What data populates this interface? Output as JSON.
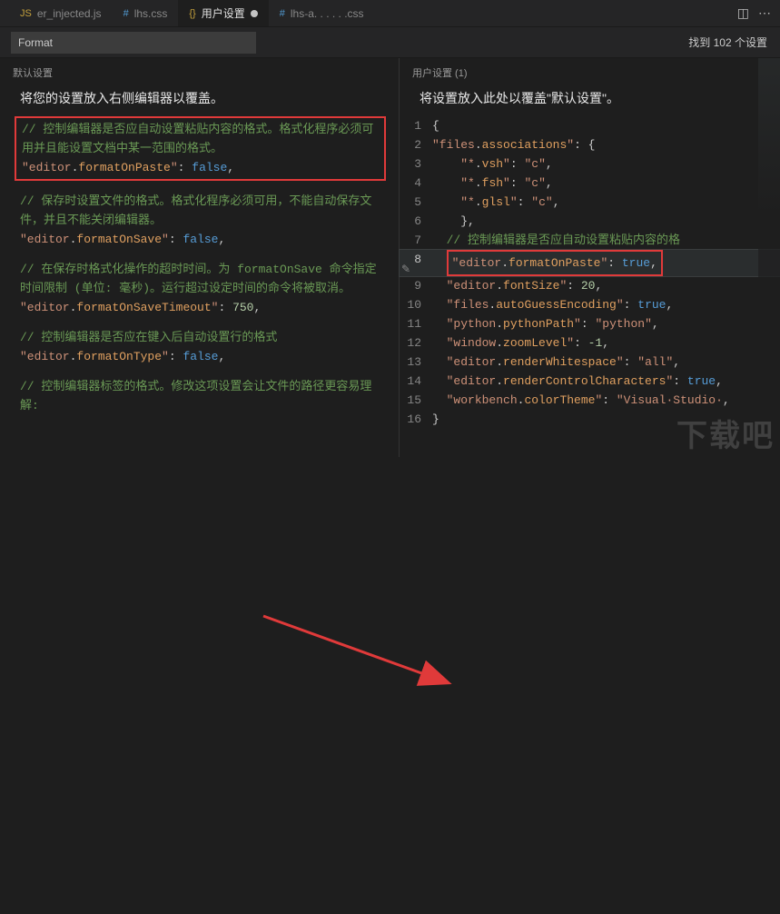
{
  "tabs": [
    {
      "icon": "JS",
      "iconClass": "js",
      "label": "er_injected.js"
    },
    {
      "icon": "#",
      "iconClass": "css",
      "label": "lhs.css"
    },
    {
      "icon": "{}",
      "iconClass": "brace",
      "label": "用户设置",
      "active": true,
      "dirty": true
    },
    {
      "icon": "#",
      "iconClass": "css",
      "label": "lhs-a. . . . . .css"
    }
  ],
  "titleActions": {
    "split": "split-icon",
    "more": "more-icon"
  },
  "search": {
    "value": "Format",
    "count": "找到 102 个设置"
  },
  "left": {
    "header": "默认设置",
    "subtitle": "将您的设置放入右侧编辑器以覆盖。",
    "blocks": [
      {
        "comment": "// 控制编辑器是否应自动设置粘贴内容的格式。格式化程序必须可用并且能设置文档中某一范围的格式。",
        "key": "editor.formatOnPaste",
        "val": "false",
        "type": "bool"
      },
      {
        "comment": "// 保存时设置文件的格式。格式化程序必须可用，不能自动保存文件，并且不能关闭编辑器。",
        "key": "editor.formatOnSave",
        "val": "false",
        "type": "bool"
      },
      {
        "comment": "// 在保存时格式化操作的超时时间。为 formatOnSave 命令指定时间限制 (单位: 毫秒)。运行超过设定时间的命令将被取消。",
        "key": "editor.formatOnSaveTimeout",
        "val": "750",
        "type": "num"
      },
      {
        "comment": "// 控制编辑器是否应在键入后自动设置行的格式",
        "key": "editor.formatOnType",
        "val": "false",
        "type": "bool"
      },
      {
        "comment": "// 控制编辑器标签的格式。修改这项设置会让文件的路径更容易理解:",
        "key": "",
        "val": "",
        "type": ""
      }
    ]
  },
  "right": {
    "header": "用户设置 (1)",
    "subtitle": "将设置放入此处以覆盖\"默认设置\"。",
    "lines": [
      {
        "n": 1,
        "txt": "{"
      },
      {
        "n": 2,
        "key": "files.associations",
        "val": "{",
        "open": true
      },
      {
        "n": 3,
        "key": "*.vsh",
        "val": "\"c\"",
        "type": "str",
        "indent": 2
      },
      {
        "n": 4,
        "key": "*.fsh",
        "val": "\"c\"",
        "type": "str",
        "indent": 2
      },
      {
        "n": 5,
        "key": "*.glsl",
        "val": "\"c\"",
        "type": "str",
        "indent": 2
      },
      {
        "n": 6,
        "txt": "  },",
        "indent": 1
      },
      {
        "n": 7,
        "comment": "// 控制编辑器是否应自动设置粘贴内容的格",
        "indent": 1
      },
      {
        "n": 8,
        "key": "editor.formatOnPaste",
        "val": "true",
        "type": "bool",
        "indent": 1,
        "cur": true,
        "boxed": true
      },
      {
        "n": 9,
        "key": "editor.fontSize",
        "val": "20",
        "type": "num",
        "indent": 1
      },
      {
        "n": 10,
        "key": "files.autoGuessEncoding",
        "val": "true",
        "type": "bool",
        "indent": 1
      },
      {
        "n": 11,
        "key": "python.pythonPath",
        "val": "\"python\"",
        "type": "str",
        "indent": 1
      },
      {
        "n": 12,
        "key": "window.zoomLevel",
        "val": "-1",
        "type": "num",
        "indent": 1
      },
      {
        "n": 13,
        "key": "editor.renderWhitespace",
        "val": "\"all\"",
        "type": "str",
        "indent": 1
      },
      {
        "n": 14,
        "key": "editor.renderControlCharacters",
        "val": "true",
        "type": "bool",
        "indent": 1
      },
      {
        "n": 15,
        "key": "workbench.colorTheme",
        "val": "\"Visual·Studio·",
        "type": "str",
        "indent": 1
      },
      {
        "n": 16,
        "txt": "}"
      }
    ]
  },
  "watermark": "下载吧"
}
